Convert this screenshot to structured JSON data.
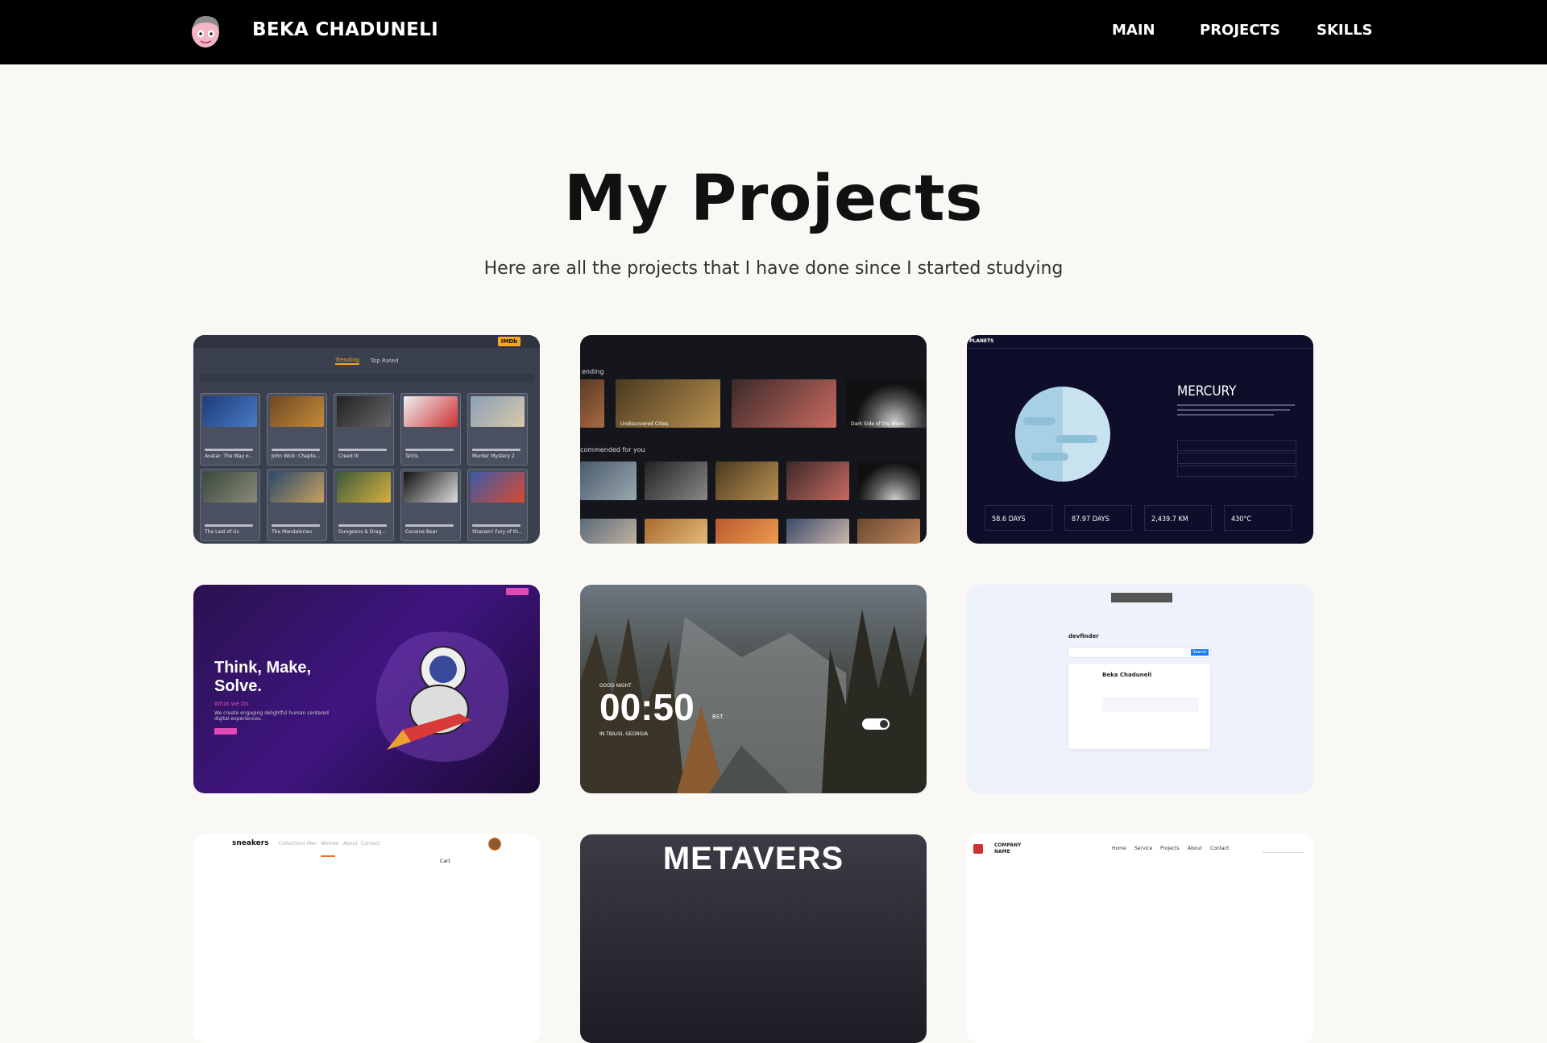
{
  "nav": {
    "brand": "BEKA CHADUNELI",
    "links": [
      "MAIN",
      "PROJECTS",
      "SKILLS"
    ]
  },
  "main": {
    "title": "My Projects",
    "subtitle": "Here are all the projects that I have done since I started studying"
  },
  "projects": {
    "imdb": {
      "logo": "IMDb",
      "tabs": [
        "Trending",
        "Top Rated"
      ],
      "movies": [
        "Avatar: The Way o...",
        "John Wick: Chapte...",
        "Creed III",
        "Tetris",
        "Murder Mystery 2",
        "The Last of Us",
        "The Mandalorian",
        "Dungeons & Drag...",
        "Cocaine Bear",
        "Shazam! Fury of th..."
      ]
    },
    "movies": {
      "section_trending": "ending",
      "section_recommended": "commended for you",
      "captions": [
        "Undiscovered Cities",
        "Dark Side of the Moon"
      ]
    },
    "planets": {
      "brand": "PLANETS",
      "planet_name": "MERCURY",
      "stats": [
        "58.6 DAYS",
        "87.97 DAYS",
        "2,439.7 KM",
        "430°C"
      ]
    },
    "agency": {
      "headline_1": "Think, Make,",
      "headline_2": "Solve.",
      "tagline": "What we Do",
      "description": "We create engaging delightful human centered digital experiences."
    },
    "clock": {
      "time": "00:50",
      "suffix": "BST",
      "location": "IN TBILISI, GEORGIA",
      "greeting": "GOOD NIGHT"
    },
    "github": {
      "app_name": "devfinder",
      "user_name": "Beka Chaduneli",
      "search_button": "Search"
    },
    "sneakers": {
      "brand": "sneakers",
      "nav": [
        "Collections",
        "Men",
        "Women",
        "About",
        "Contact"
      ],
      "cart": "Cart"
    },
    "metaverse": {
      "headline": "METAVERS"
    },
    "company": {
      "brand_line_1": "COMPANY",
      "brand_line_2": "NAME",
      "nav": [
        "Home",
        "Service",
        "Projects",
        "About",
        "Contact"
      ]
    }
  }
}
